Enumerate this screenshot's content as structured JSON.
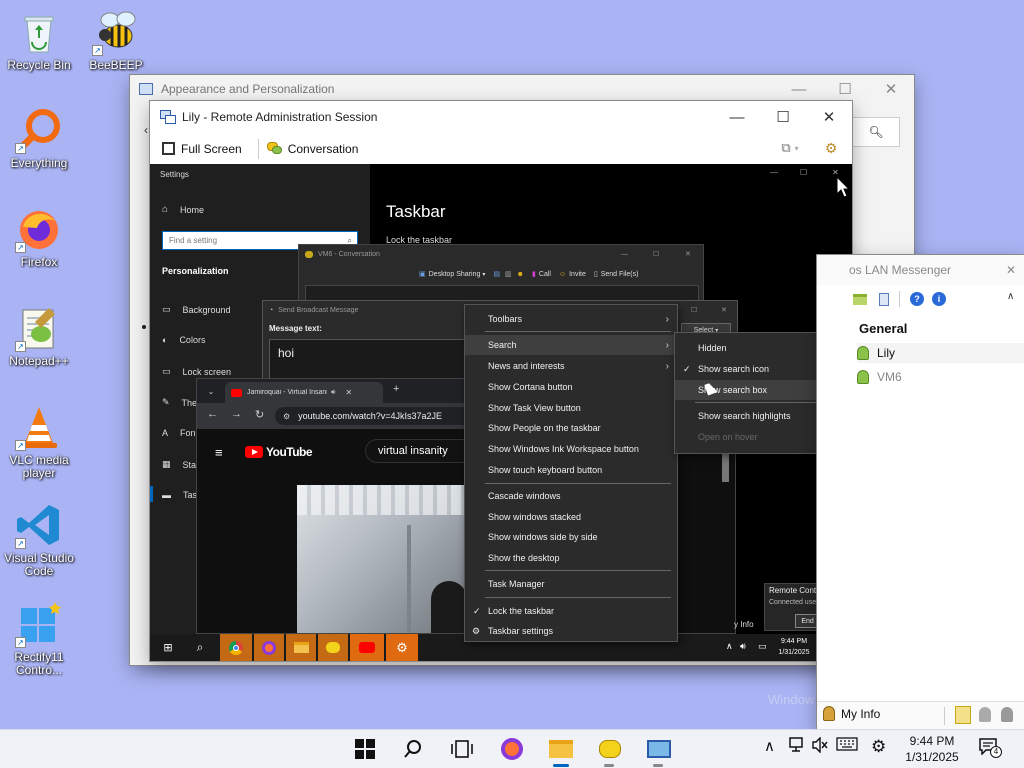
{
  "desktop": {
    "icons": [
      {
        "label": "Recycle Bin"
      },
      {
        "label": "BeeBEEP"
      },
      {
        "label": "Everything"
      },
      {
        "label": "Firefox"
      },
      {
        "label": "Notepad++"
      },
      {
        "label": "VLC media player"
      },
      {
        "label": "Visual Studio Code"
      },
      {
        "label": "Rectify11 Contro..."
      }
    ],
    "watermark": "Window"
  },
  "control_panel": {
    "title": "Appearance and Personalization"
  },
  "remote": {
    "title": "Lily - Remote Administration Session",
    "full_screen": "Full Screen",
    "conversation": "Conversation"
  },
  "settings": {
    "title": "Settings",
    "home": "Home",
    "search_placeholder": "Find a setting",
    "section": "Personalization",
    "nav": [
      "Background",
      "Colors",
      "Lock screen",
      "The",
      "Fon",
      "Sta",
      "Tas"
    ],
    "page_title": "Taskbar",
    "lock_label": "Lock the taskbar"
  },
  "vm_conversation": {
    "title": "VM6 - Conversation",
    "desktop_sharing": "Desktop Sharing",
    "call": "Call",
    "invite": "Invite",
    "send_files": "Send File(s)"
  },
  "broadcast": {
    "title": "Send Broadcast Message",
    "label": "Message text:",
    "value": "hoi",
    "select": "Select"
  },
  "browser": {
    "tab_title": "Jamiroquai - Virtual Insanity",
    "url": "youtube.com/watch?v=4JkIs37a2JE",
    "brand": "YouTube",
    "query": "virtual insanity"
  },
  "remote_taskbar": {
    "time": "9:44 PM",
    "date": "1/31/2025",
    "notif_count": "2",
    "partial_info": "y Info"
  },
  "taskbar_menu": {
    "items": [
      "Toolbars",
      "Search",
      "News and interests",
      "Show Cortana button",
      "Show Task View button",
      "Show People on the taskbar",
      "Show Windows Ink Workspace button",
      "Show touch keyboard button",
      "Cascade windows",
      "Show windows stacked",
      "Show windows side by side",
      "Show the desktop",
      "Task Manager",
      "Lock the taskbar",
      "Taskbar settings"
    ]
  },
  "search_submenu": {
    "items": [
      "Hidden",
      "Show search icon",
      "Show search box",
      "Show search highlights",
      "Open on hover"
    ]
  },
  "remote_control": {
    "title": "Remote Control",
    "connected": "Connected user: VM6",
    "end_session": "End Session"
  },
  "lan": {
    "title": "os LAN Messenger",
    "group": "General",
    "users": [
      "Lily",
      "VM6"
    ],
    "my_info": "My Info"
  },
  "taskbar": {
    "time": "9:44 PM",
    "date": "1/31/2025",
    "notif_count": "4"
  },
  "colors": {
    "desktop": "#aab4f4",
    "accent": "#0067c0",
    "menu": "#2b2b2b"
  }
}
